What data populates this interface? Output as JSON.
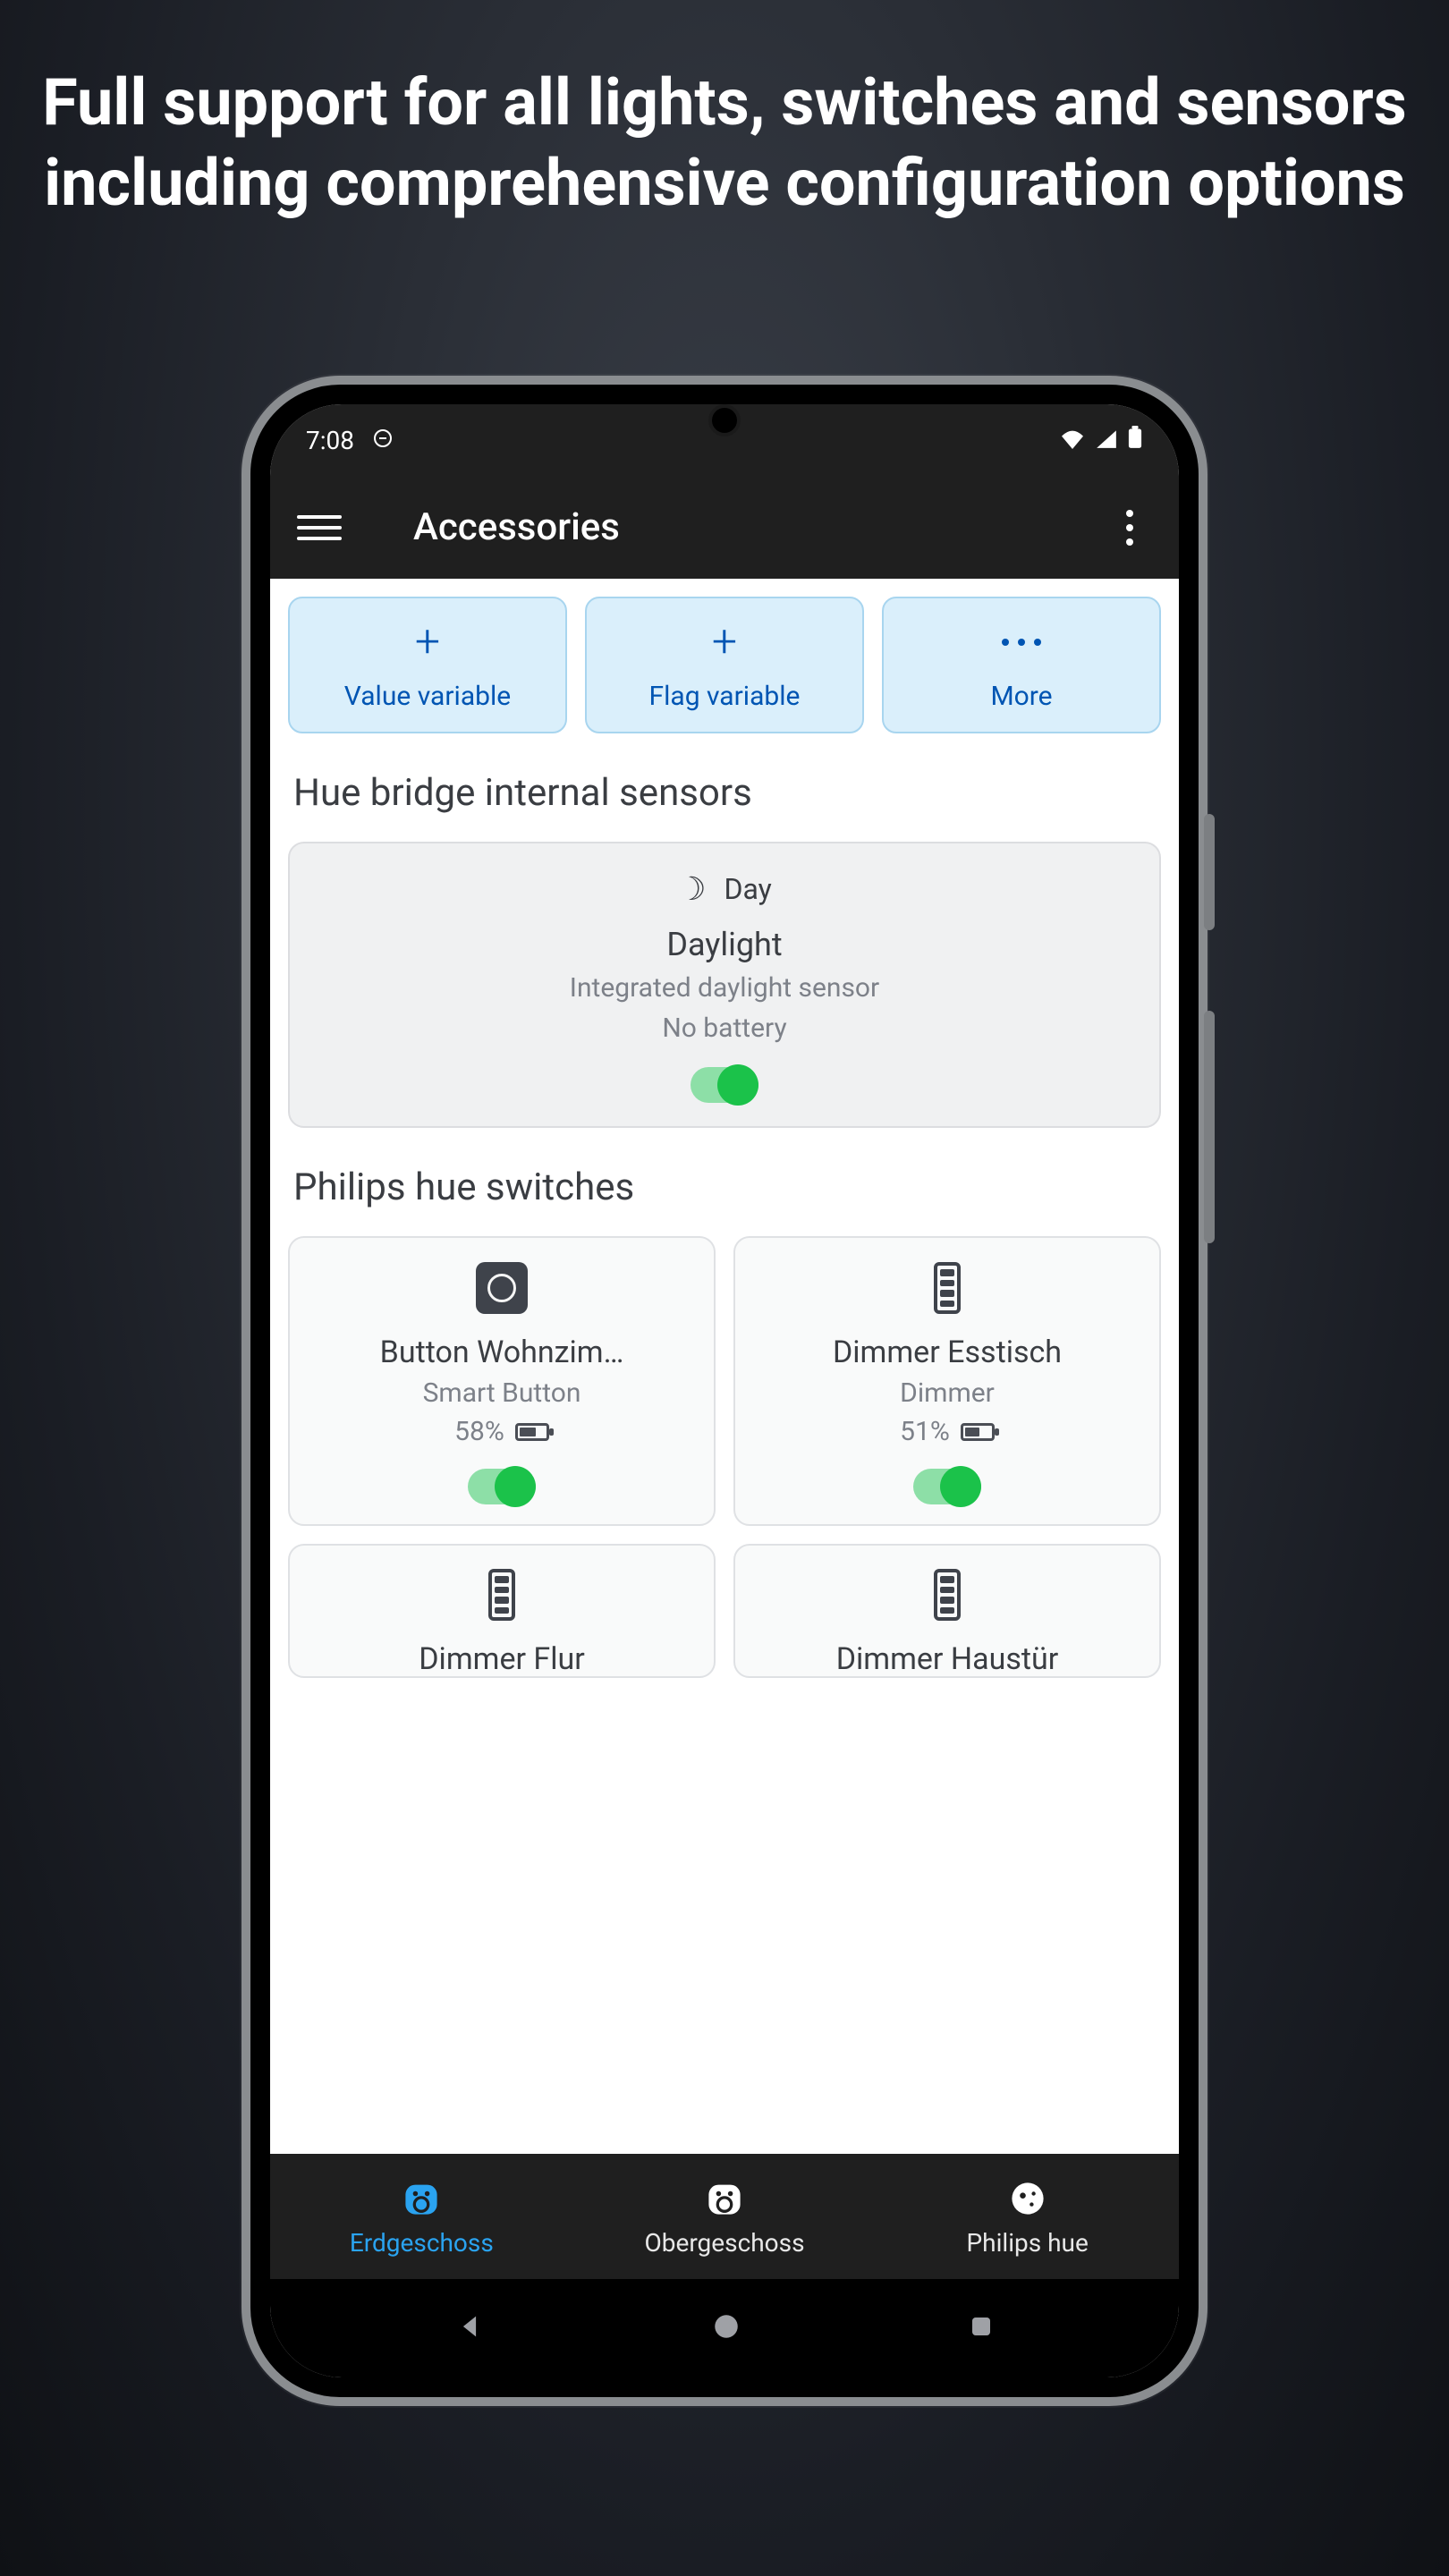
{
  "promo": {
    "heading": "Full support for all lights, switches and sensors including comprehen­sive configuration options"
  },
  "status_bar": {
    "time": "7:08"
  },
  "app_bar": {
    "title": "Accessories"
  },
  "actions": [
    {
      "icon": "plus",
      "label": "Value variable"
    },
    {
      "icon": "plus",
      "label": "Flag variable"
    },
    {
      "icon": "dots",
      "label": "More"
    }
  ],
  "sections": {
    "sensors": {
      "heading": "Hue bridge internal sensors",
      "items": [
        {
          "status_label": "Day",
          "name": "Daylight",
          "description": "Integrated daylight sensor",
          "battery": "No battery",
          "enabled": true
        }
      ]
    },
    "switches": {
      "heading": "Philips hue switches",
      "items": [
        {
          "icon": "smart-button",
          "name": "Button Wohnzim…",
          "type": "Smart Button",
          "battery_pct": "58%",
          "battery_fill": 58,
          "enabled": true
        },
        {
          "icon": "dimmer",
          "name": "Dimmer Esstisch",
          "type": "Dimmer",
          "battery_pct": "51%",
          "battery_fill": 51,
          "enabled": true
        },
        {
          "icon": "dimmer",
          "name": "Dimmer Flur",
          "type": "",
          "battery_pct": "",
          "enabled": true
        },
        {
          "icon": "dimmer",
          "name": "Dimmer Haustür",
          "type": "",
          "battery_pct": "",
          "enabled": true
        }
      ]
    }
  },
  "bottom_nav": [
    {
      "label": "Erdgeschoss",
      "active": true
    },
    {
      "label": "Obergeschoss",
      "active": false
    },
    {
      "label": "Philips hue",
      "active": false
    }
  ]
}
